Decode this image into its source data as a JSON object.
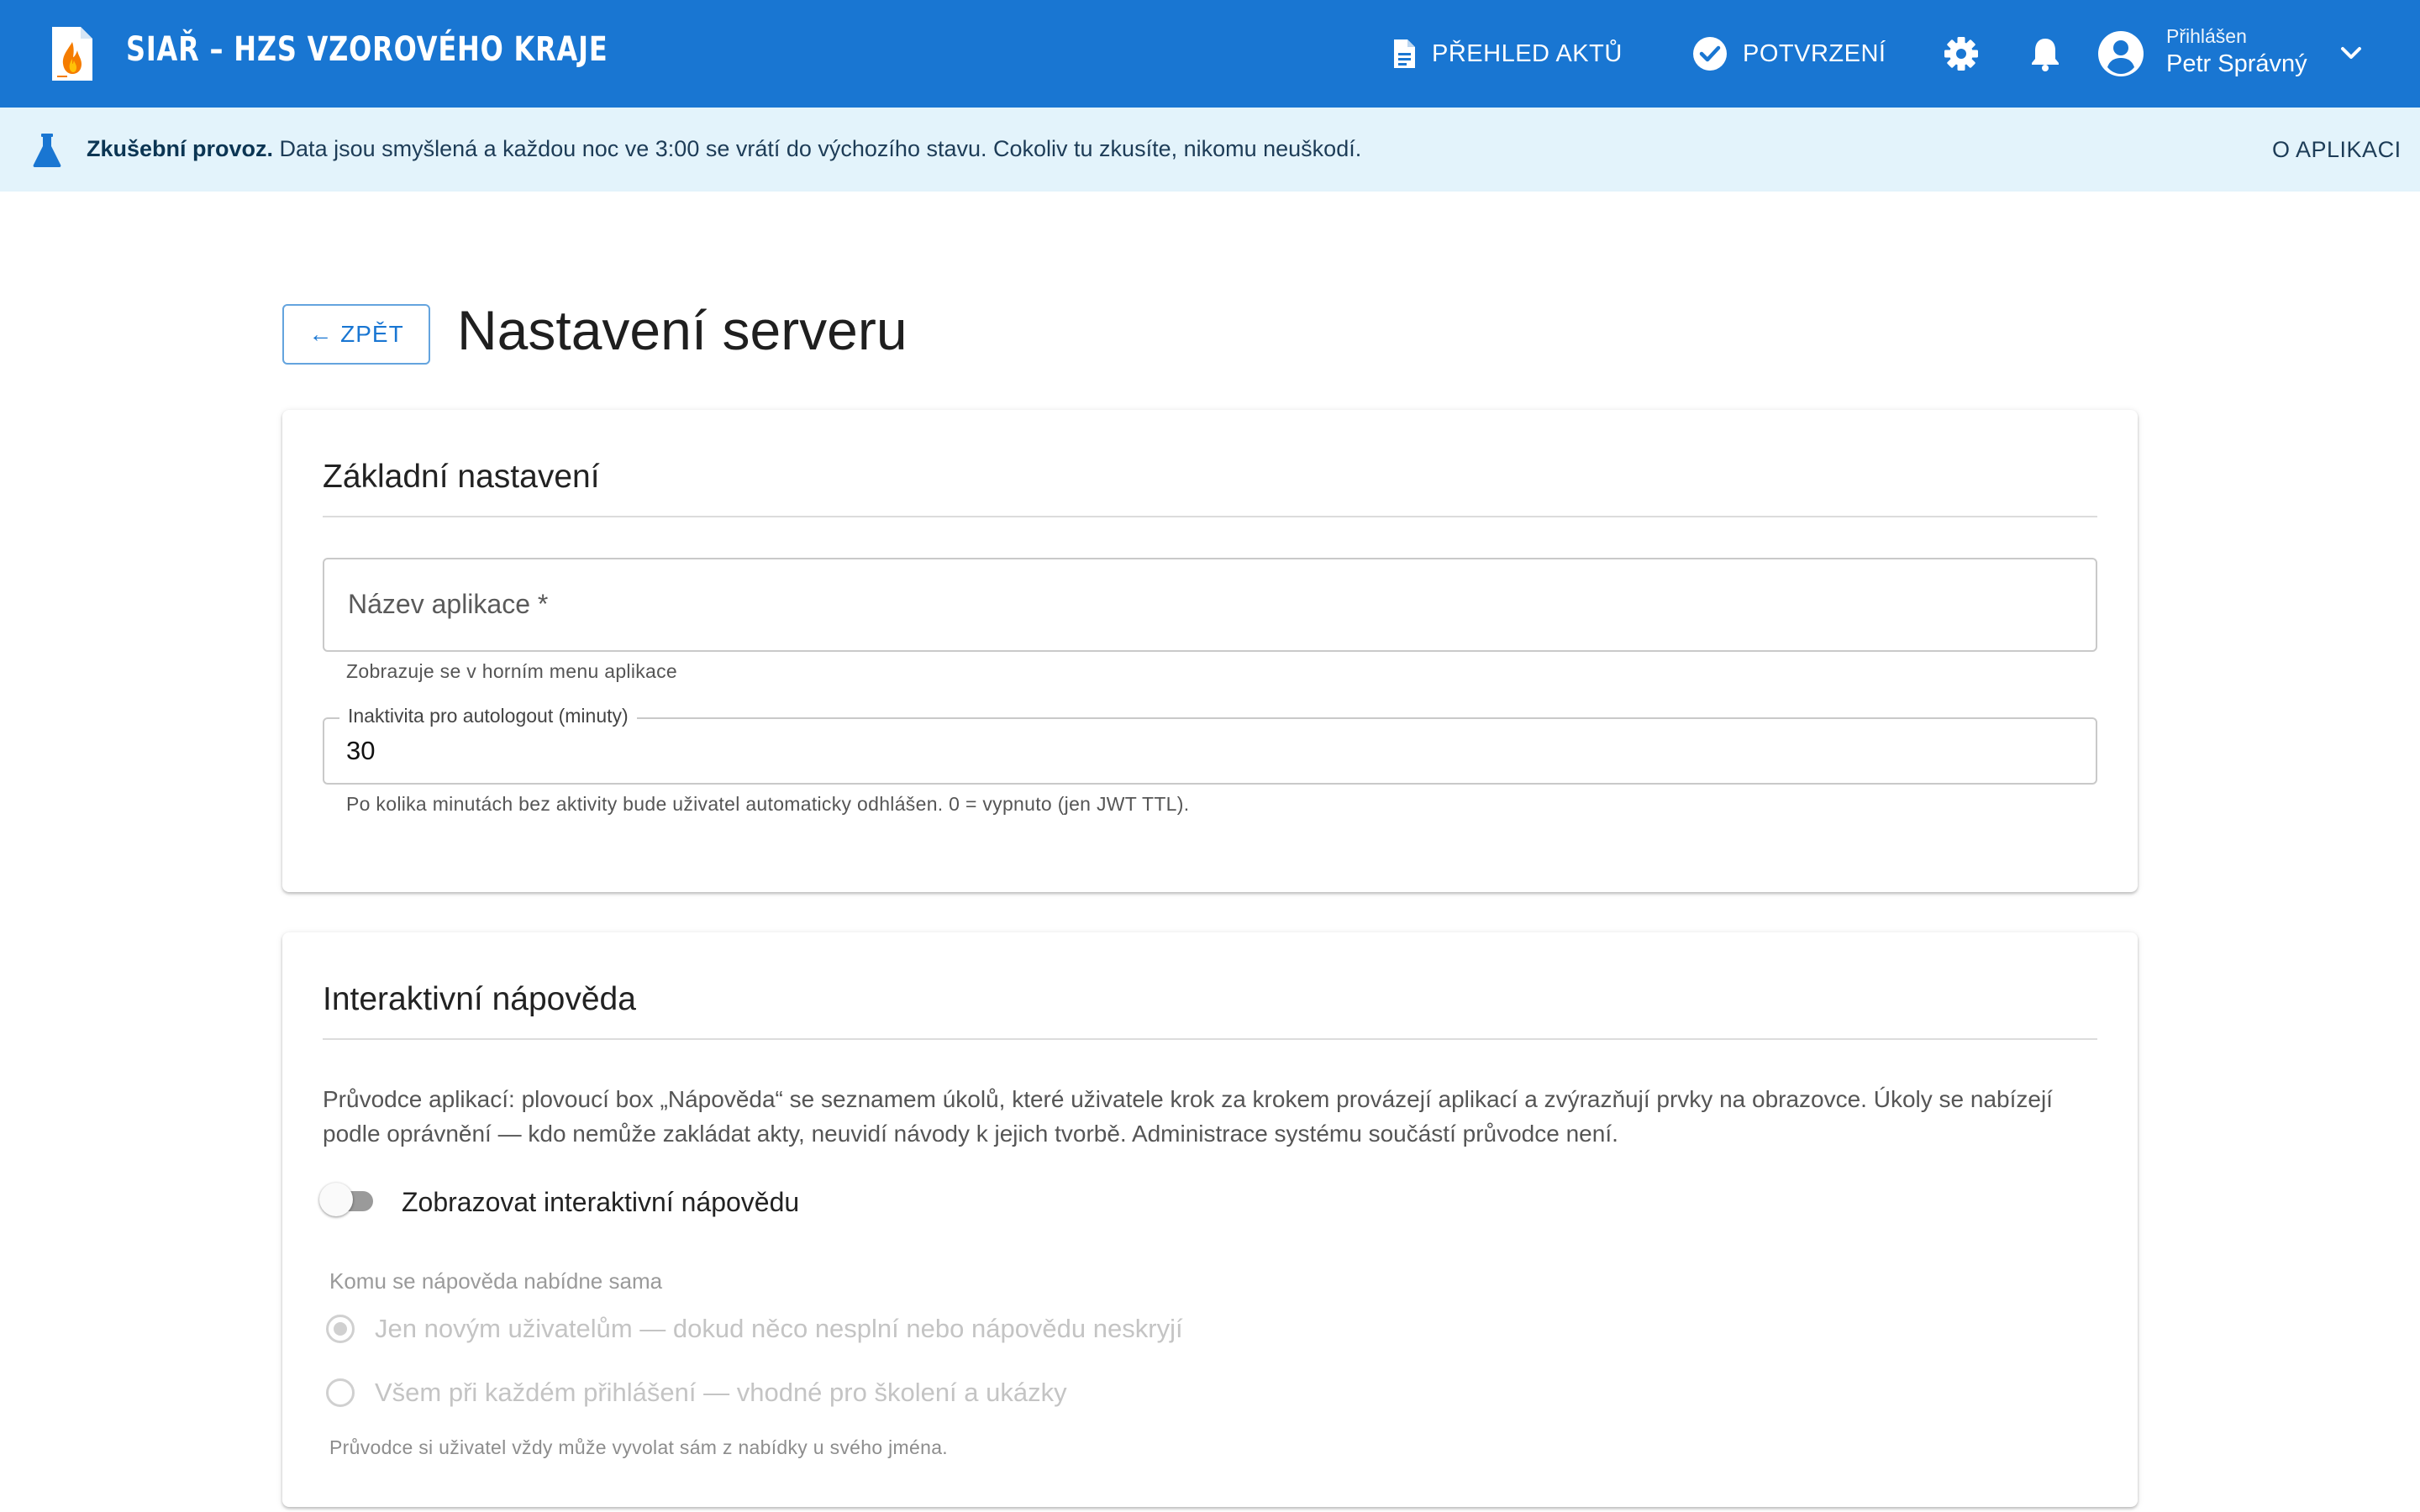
{
  "header": {
    "app_title": "SIAŘ – HZS VZOROVÉHO KRAJE",
    "nav_acts_label": "PŘEHLED AKTŮ",
    "nav_confirm_label": "POTVRZENÍ",
    "user_caption": "Přihlášen",
    "user_name": "Petr Správný",
    "colors": {
      "primary": "#1976d2"
    }
  },
  "infobar": {
    "strong": "Zkušební provoz.",
    "text": "Data jsou smyšlená a každou noc ve 3:00 se vrátí do výchozího stavu. Cokoliv tu zkusíte, nikomu neuškodí.",
    "about_label": "O APLIKACI",
    "background": "#e3f3fb"
  },
  "page": {
    "back_label": "← ZPĚT",
    "title": "Nastavení serveru"
  },
  "basic": {
    "title": "Základní nastavení",
    "app_name": {
      "label": "Název aplikace *",
      "value": "",
      "hint": "Zobrazuje se v horním menu aplikace"
    },
    "inactivity": {
      "label": "Inaktivita pro autologout (minuty)",
      "value": "30",
      "hint": "Po kolika minutách bez aktivity bude uživatel automaticky odhlášen. 0 = vypnuto (jen JWT TTL)."
    }
  },
  "help": {
    "title": "Interaktivní nápověda",
    "description": "Průvodce aplikací: plovoucí box „Nápověda“ se seznamem úkolů, které uživatele krok za krokem provázejí aplikací a zvýrazňují prvky na obrazovce. Úkoly se nabízejí podle oprávnění — kdo nemůže zakládat akty, neuvidí návody k jejich tvorbě. Administrace systému součástí průvodce není.",
    "toggle_label": "Zobrazovat interaktivní nápovědu",
    "toggle_on": false,
    "group_label": "Komu se nápověda nabídne sama",
    "options": [
      {
        "label": "Jen novým uživatelům — dokud něco nesplní nebo nápovědu neskryjí",
        "selected": true
      },
      {
        "label": "Všem při každém přihlášení — vhodné pro školení a ukázky",
        "selected": false
      }
    ],
    "footer_hint": "Průvodce si uživatel vždy může vyvolat sám z nabídky u svého jména."
  }
}
